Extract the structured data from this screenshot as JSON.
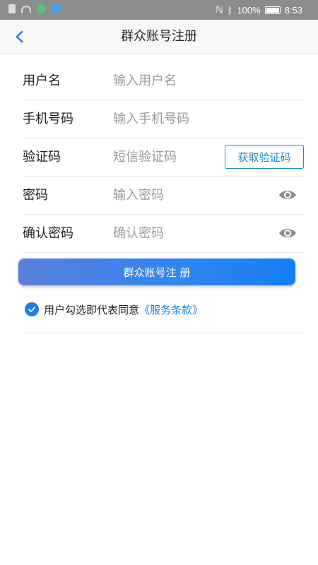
{
  "status_bar": {
    "battery": "100%",
    "time": "8:53",
    "icons": [
      "file-icon",
      "wifi-icon",
      "app-green-icon",
      "app-blue-icon",
      "nfc-icon",
      "bluetooth-icon",
      "battery-icon"
    ]
  },
  "nav": {
    "title": "群众账号注册",
    "back_icon": "chevron-left-icon"
  },
  "form": {
    "username": {
      "label": "用户名",
      "placeholder": "输入用户名",
      "value": ""
    },
    "phone": {
      "label": "手机号码",
      "placeholder": "输入手机号码",
      "value": ""
    },
    "code": {
      "label": "验证码",
      "placeholder": "短信验证码",
      "value": "",
      "button": "获取验证码"
    },
    "password": {
      "label": "密码",
      "placeholder": "输入密码",
      "value": "",
      "icon": "eye-icon"
    },
    "confirm": {
      "label": "确认密码",
      "placeholder": "确认密码",
      "value": "",
      "icon": "eye-icon"
    }
  },
  "register_button": "群众账号注 册",
  "agreement": {
    "checked": true,
    "text": "用户勾选即代表同意",
    "link": "《服务条款》"
  },
  "colors": {
    "accent": "#1b7fe6",
    "code_button": "#1a8cc8",
    "status_bar": "#8c8c8c"
  }
}
